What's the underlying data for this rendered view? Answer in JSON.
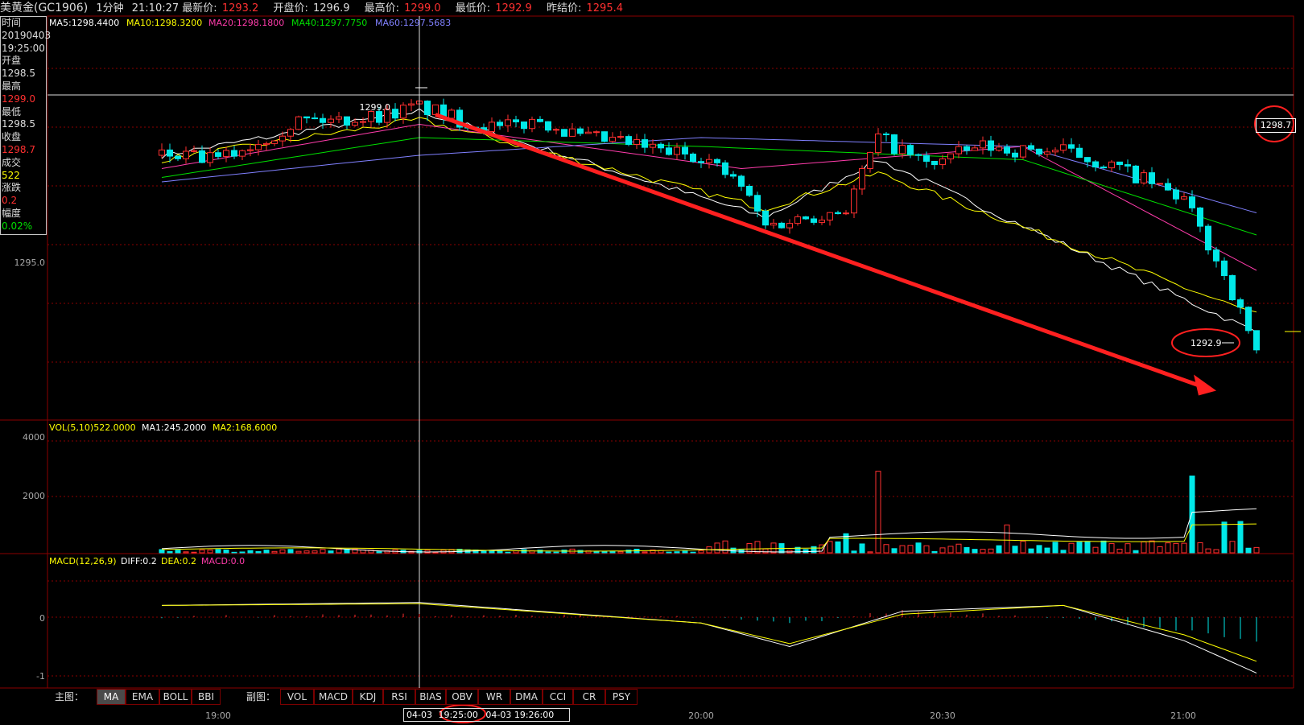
{
  "header": {
    "symbol": "美黄金(GC1906)",
    "period": "1分钟",
    "time": "21:10:27",
    "last_label": "最新价:",
    "last_value": "1293.2",
    "open_label": "开盘价:",
    "open_value": "1296.9",
    "high_label": "最高价:",
    "high_value": "1299.0",
    "low_label": "最低价:",
    "low_value": "1292.9",
    "prev_label": "昨结价:",
    "prev_value": "1295.4"
  },
  "info_box": {
    "time_label": "时间",
    "date": "20190403",
    "time": "19:25:00",
    "open_label": "开盘",
    "open": "1298.5",
    "high_label": "最高",
    "high": "1299.0",
    "low_label": "最低",
    "low": "1298.5",
    "close_label": "收盘",
    "close": "1298.7",
    "volume_label": "成交",
    "volume": "522",
    "change_label": "涨跌",
    "change": "0.2",
    "amp_label": "幅度",
    "amp": "0.02%"
  },
  "ma_legend": [
    {
      "text": "MA5:1298.4400",
      "color": "#ffffff"
    },
    {
      "text": "MA10:1298.3200",
      "color": "#ffff00"
    },
    {
      "text": "MA20:1298.1800",
      "color": "#ff3cab"
    },
    {
      "text": "MA40:1297.7750",
      "color": "#00e000"
    },
    {
      "text": "MA60:1297.5683",
      "color": "#8080ff"
    }
  ],
  "vol_legend": {
    "main": "VOL(5,10)522.0000",
    "ma1": "MA1:245.2000",
    "ma2": "MA2:168.6000"
  },
  "macd_legend": {
    "main": "MACD(12,26,9)",
    "diff": "DIFF:0.2",
    "dea": "DEA:0.2",
    "macd": "MACD:0.0"
  },
  "price_axis": {
    "tick_1295": "1295.0"
  },
  "vol_axis": {
    "tick_4000": "4000",
    "tick_2000": "2000"
  },
  "macd_axis": {
    "tick_0": "0",
    "tick_m1": "-1"
  },
  "annotations": {
    "cross_price": "1299.0",
    "right_price": "1298.7",
    "low_price": "1292.9"
  },
  "time_axis": {
    "t1": "19:00",
    "t2": "20:00",
    "t3": "20:30",
    "t4": "21:00"
  },
  "time_cursor": {
    "date": "04-03",
    "time": "19:25:00",
    "next": "04-03 19:26:00"
  },
  "toolbar": {
    "main_label": "主图：",
    "main_buttons": [
      "MA",
      "EMA",
      "BOLL",
      "BBI"
    ],
    "sub_label": "副图：",
    "sub_buttons": [
      "VOL",
      "MACD",
      "KDJ",
      "RSI",
      "BIAS",
      "OBV",
      "WR",
      "DMA",
      "CCI",
      "CR",
      "PSY"
    ]
  },
  "colors": {
    "up": "#ff3030",
    "down": "#00e8e8",
    "grid": "#8b0000",
    "bg": "#000000"
  },
  "chart_data": [
    {
      "type": "candlestick",
      "title": "美黄金(GC1906) 1分钟",
      "x_range": [
        "18:53",
        "21:10"
      ],
      "ylim": [
        1291.8,
        1300.2
      ],
      "y_ticks": [
        1295.0
      ],
      "last": 1293.2,
      "open": 1296.9,
      "high": 1299.0,
      "low": 1292.9,
      "prev_settle": 1295.4,
      "path_close": [
        [
          "18:53",
          1297.6
        ],
        [
          "19:00",
          1297.5
        ],
        [
          "19:05",
          1297.9
        ],
        [
          "19:10",
          1298.4
        ],
        [
          "19:15",
          1298.4
        ],
        [
          "19:20",
          1298.5
        ],
        [
          "19:25",
          1298.7
        ],
        [
          "19:30",
          1298.4
        ],
        [
          "19:35",
          1298.2
        ],
        [
          "19:40",
          1298.4
        ],
        [
          "19:45",
          1298.0
        ],
        [
          "19:50",
          1297.9
        ],
        [
          "19:55",
          1297.7
        ],
        [
          "20:00",
          1297.6
        ],
        [
          "20:05",
          1296.9
        ],
        [
          "20:08",
          1296.0
        ],
        [
          "20:13",
          1296.2
        ],
        [
          "20:18",
          1296.4
        ],
        [
          "20:22",
          1298.0
        ],
        [
          "20:28",
          1297.4
        ],
        [
          "20:35",
          1297.8
        ],
        [
          "20:40",
          1297.7
        ],
        [
          "20:45",
          1297.7
        ],
        [
          "20:52",
          1297.3
        ],
        [
          "21:00",
          1296.6
        ],
        [
          "21:05",
          1294.9
        ],
        [
          "21:09",
          1293.2
        ]
      ],
      "series": [
        {
          "name": "MA5",
          "last": 1298.44,
          "path": [
            [
              "18:53",
              1297.6
            ],
            [
              "19:25",
              1298.6
            ],
            [
              "20:08",
              1296.2
            ],
            [
              "20:22",
              1297.5
            ],
            [
              "21:09",
              1293.6
            ]
          ]
        },
        {
          "name": "MA10",
          "last": 1298.32,
          "path": [
            [
              "18:53",
              1297.5
            ],
            [
              "19:25",
              1298.4
            ],
            [
              "20:08",
              1296.4
            ],
            [
              "20:22",
              1297.2
            ],
            [
              "21:09",
              1294.0
            ]
          ]
        },
        {
          "name": "MA20",
          "last": 1298.18,
          "path": [
            [
              "18:53",
              1297.3
            ],
            [
              "19:25",
              1298.3
            ],
            [
              "20:05",
              1297.3
            ],
            [
              "20:40",
              1297.8
            ],
            [
              "21:09",
              1295.0
            ]
          ]
        },
        {
          "name": "MA40",
          "last": 1297.775,
          "path": [
            [
              "18:53",
              1297.1
            ],
            [
              "19:25",
              1298.0
            ],
            [
              "20:00",
              1297.8
            ],
            [
              "20:40",
              1297.5
            ],
            [
              "21:09",
              1295.8
            ]
          ]
        },
        {
          "name": "MA60",
          "last": 1297.5683,
          "path": [
            [
              "18:53",
              1297.0
            ],
            [
              "19:25",
              1297.6
            ],
            [
              "20:00",
              1298.0
            ],
            [
              "20:40",
              1297.8
            ],
            [
              "21:09",
              1296.3
            ]
          ]
        }
      ],
      "annotations": [
        "1299.0",
        "1298.7",
        "1292.9"
      ]
    },
    {
      "type": "bar",
      "title": "VOL(5,10)",
      "ylim": [
        0,
        4600
      ],
      "y_ticks": [
        2000,
        4000
      ],
      "last": 522.0,
      "ma1": 245.2,
      "ma2": 168.6,
      "spikes": [
        [
          "20:22",
          3100
        ],
        [
          "21:01",
          2500
        ],
        [
          "21:01",
          2900
        ],
        [
          "21:05",
          1400
        ],
        [
          "21:07",
          1300
        ],
        [
          "20:18",
          800
        ],
        [
          "20:38",
          1200
        ]
      ]
    },
    {
      "type": "bar",
      "title": "MACD(12,26,9)",
      "ylim": [
        -1.25,
        1.0
      ],
      "y_ticks": [
        0,
        -1
      ],
      "diff": 0.2,
      "dea": 0.2,
      "macd": 0.0,
      "series": [
        {
          "name": "DIFF",
          "path": [
            [
              "18:53",
              0.2
            ],
            [
              "19:25",
              0.25
            ],
            [
              "20:00",
              -0.1
            ],
            [
              "20:11",
              -0.5
            ],
            [
              "20:25",
              0.1
            ],
            [
              "20:45",
              0.2
            ],
            [
              "21:00",
              -0.4
            ],
            [
              "21:09",
              -0.95
            ]
          ]
        },
        {
          "name": "DEA",
          "path": [
            [
              "18:53",
              0.2
            ],
            [
              "19:25",
              0.23
            ],
            [
              "20:00",
              -0.1
            ],
            [
              "20:11",
              -0.45
            ],
            [
              "20:25",
              0.05
            ],
            [
              "20:45",
              0.2
            ],
            [
              "21:00",
              -0.3
            ],
            [
              "21:09",
              -0.75
            ]
          ]
        }
      ]
    }
  ]
}
